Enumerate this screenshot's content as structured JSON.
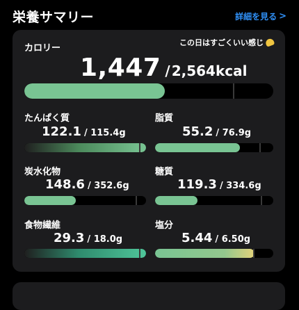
{
  "header": {
    "title": "栄養サマリー",
    "link_label": "詳細を見る",
    "link_chevron": ">"
  },
  "calorie": {
    "label": "カロリー",
    "comment": "この日はすごくいい感じ",
    "value": "1,447",
    "separator": "/",
    "target": "2,564kcal",
    "progress": 0.564
  },
  "nutrients": [
    {
      "name": "たんぱく質",
      "value": "122.1",
      "target": "/ 115.4g",
      "progress": 1.06
    },
    {
      "name": "脂質",
      "value": "55.2",
      "target": "/ 76.9g",
      "progress": 0.72
    },
    {
      "name": "炭水化物",
      "value": "148.6",
      "target": "/ 352.6g",
      "progress": 0.42
    },
    {
      "name": "糖質",
      "value": "119.3",
      "target": "/ 334.6g",
      "progress": 0.36
    },
    {
      "name": "食物繊維",
      "value": "29.3",
      "target": "/ 18.0g",
      "progress": 1.63
    },
    {
      "name": "塩分",
      "value": "5.44",
      "target": "/ 6.50g",
      "progress": 0.84
    }
  ],
  "colors": {
    "accent_link": "#2f8ff5",
    "bar_green": "#79c493",
    "card_bg": "#1c1c1e"
  }
}
